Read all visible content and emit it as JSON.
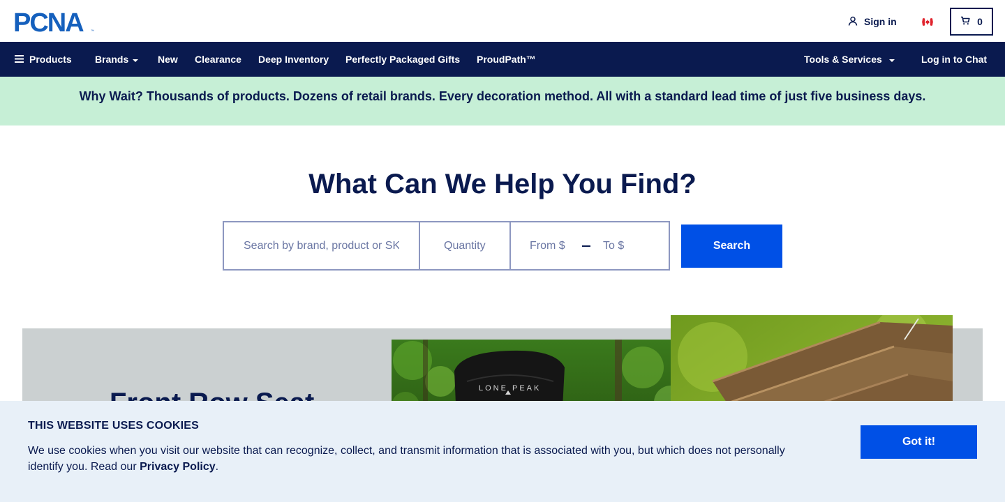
{
  "brand": {
    "logo_text": "PCNA",
    "logo_color": "#1560bd"
  },
  "header": {
    "sign_in_label": "Sign in",
    "country_flag": "canada-flag-icon",
    "cart_count": "0"
  },
  "nav": {
    "products_label": "Products",
    "brands_label": "Brands",
    "new_label": "New",
    "clearance_label": "Clearance",
    "deep_inventory_label": "Deep Inventory",
    "gifts_label": "Perfectly Packaged Gifts",
    "proudpath_label": "ProudPath™",
    "tools_label": "Tools & Services",
    "chat_label": "Log in to Chat"
  },
  "promo": {
    "text": "Why Wait? Thousands of products. Dozens of retail brands. Every decoration method. All with a standard lead time of just five business days."
  },
  "search": {
    "headline": "What Can We Help You Find?",
    "query_placeholder": "Search by brand, product or SKU",
    "quantity_placeholder": "Quantity",
    "from_placeholder": "From $",
    "to_placeholder": "To $",
    "button_label": "Search"
  },
  "hero": {
    "title": "Front Row Seat",
    "product_logo_text": "LONE PEAK"
  },
  "cookie": {
    "title": "THIS WEBSITE USES COOKIES",
    "body": "We use cookies when you visit our website that can recognize, collect, and transmit information that is associated with you, but which does not personally identify you. Read our",
    "link_label": "Privacy Policy",
    "period": ".",
    "button_label": "Got it!"
  },
  "colors": {
    "navy": "#0a1a4f",
    "accent_blue": "#0050e6",
    "promo_green": "#c6efd6",
    "cookie_bg": "#e8f0f8"
  }
}
